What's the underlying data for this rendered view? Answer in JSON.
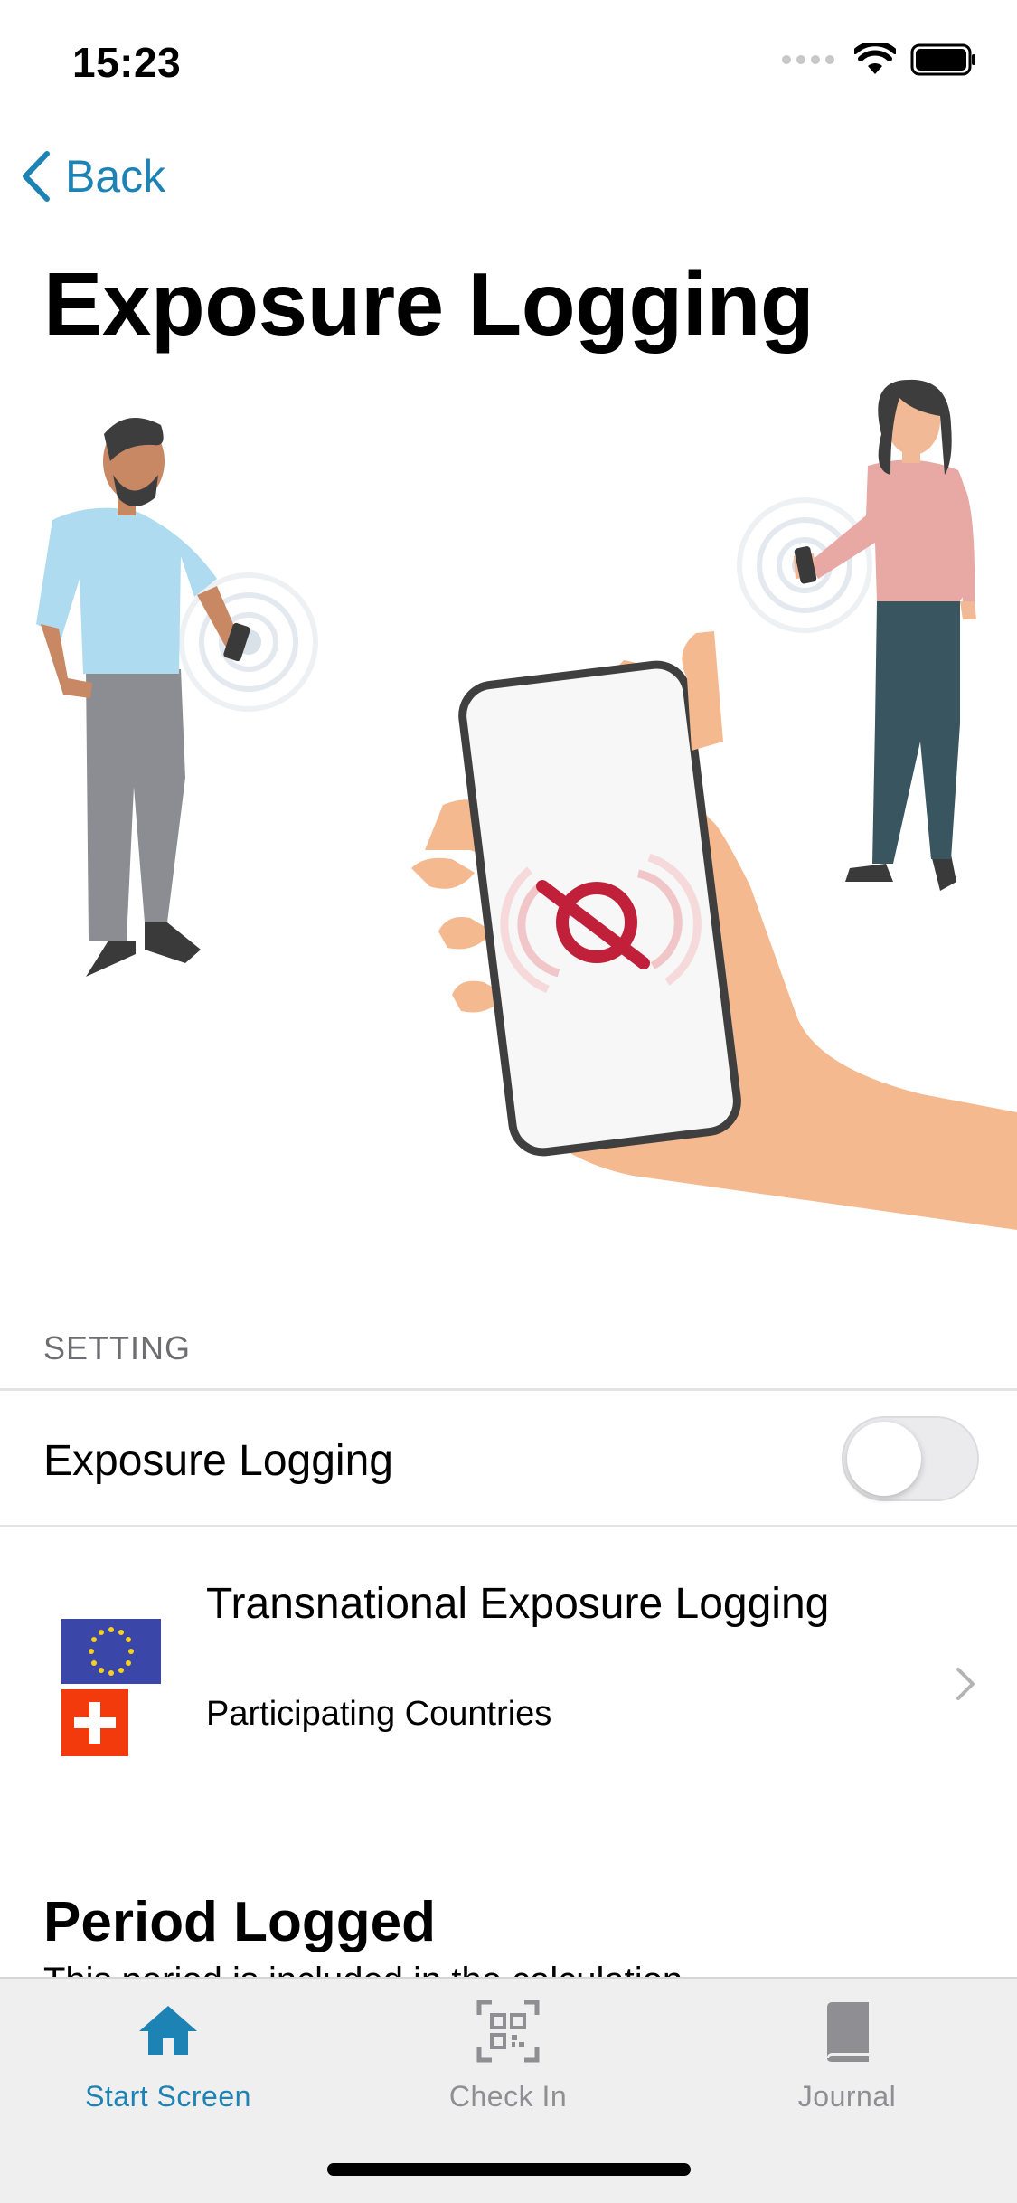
{
  "status_bar": {
    "time": "15:23"
  },
  "nav": {
    "back_label": "Back"
  },
  "page": {
    "title": "Exposure Logging"
  },
  "setting": {
    "section_header": "SETTING",
    "toggle_label": "Exposure Logging",
    "toggle_on": false
  },
  "transnational": {
    "title": "Transnational Exposure Logging",
    "subtitle": "Participating Countries"
  },
  "period": {
    "title": "Period Logged",
    "subtitle": "This period is included in the calculation"
  },
  "tabs": [
    {
      "label": "Start Screen",
      "icon": "home-icon",
      "active": true
    },
    {
      "label": "Check In",
      "icon": "qr-code-icon",
      "active": false
    },
    {
      "label": "Journal",
      "icon": "book-icon",
      "active": false
    }
  ],
  "colors": {
    "accent": "#1d82b4",
    "tab_inactive": "#8e8e93",
    "disabled_symbol": "#c0203a",
    "eu_blue": "#3b47a8",
    "swiss_red": "#f23a0c"
  }
}
